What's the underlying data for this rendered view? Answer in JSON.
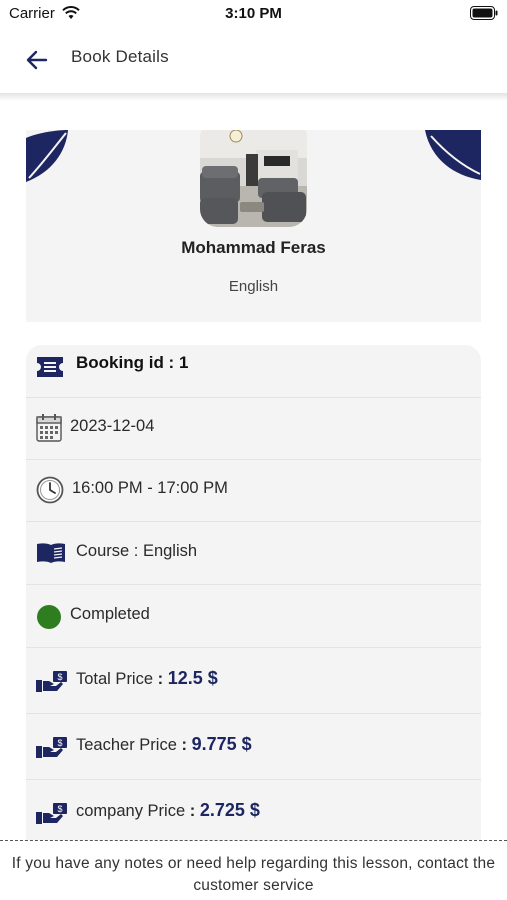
{
  "status_bar": {
    "carrier": "Carrier",
    "time": "3:10 PM"
  },
  "nav": {
    "title": "Book Details"
  },
  "teacher": {
    "name": "Mohammad Feras",
    "language": "English"
  },
  "booking": {
    "id_label": "Booking id :",
    "id_value": "1",
    "date": "2023-12-04",
    "time_range": "16:00 PM - 17:00 PM",
    "course": "Course : English",
    "status": "Completed",
    "status_color": "#2e7d1f",
    "total_label": "Total Price",
    "total_value": "12.5 $",
    "teacher_label": "Teacher Price",
    "teacher_value": "9.775 $",
    "company_label": "company Price",
    "company_value": "2.725 $",
    "separator": ":"
  },
  "footer": {
    "note": "If you have any notes or need help regarding this lesson, contact the customer service"
  },
  "colors": {
    "accent": "#1d2660",
    "card_bg": "#f4f4f4"
  }
}
